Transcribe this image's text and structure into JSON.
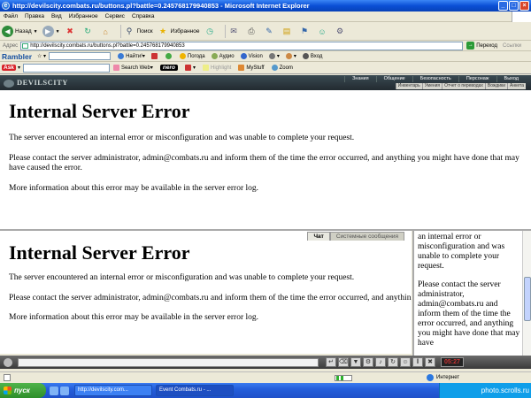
{
  "window": {
    "title": "http://devilscity.combats.ru/buttons.pl?battle=0.245768179940853 - Microsoft Internet Explorer",
    "logo_letter": "e",
    "controls": {
      "minimize": "_",
      "maximize": "□",
      "close": "×"
    }
  },
  "menu": [
    "Файл",
    "Правка",
    "Вид",
    "Избранное",
    "Сервис",
    "Справка"
  ],
  "toolbar": {
    "back": "Назад",
    "search": "Поиск",
    "favorites": "Избранное"
  },
  "address": {
    "label": "Адрес",
    "url": "http://devilscity.combats.ru/buttons.pl?battle=0.245768179940853",
    "go": "Переход",
    "links": "Ссылки"
  },
  "rambler": {
    "brand": "Rambler",
    "find": "Найти!",
    "weather": "Погода",
    "audio": "Аудио",
    "vision": "Vision",
    "login": "Вход"
  },
  "ask": {
    "brand": "Ask",
    "search_web": "Search Web",
    "nero": "nero",
    "highlight": "Highlight",
    "mystuff": "MyStuff",
    "zoom": "Zoom"
  },
  "game": {
    "logo": "DEVILSCITY",
    "topnav": [
      "Знания",
      "Общение",
      "Безопасность",
      "Персонаж",
      "Выход"
    ],
    "subnav": [
      "Инвентарь",
      "Умения",
      "Отчет о переводах",
      "Вождики",
      "Анкета"
    ]
  },
  "error": {
    "title": "Internal Server Error",
    "p1": "The server encountered an internal error or misconfiguration and was unable to complete your request.",
    "p2": "Please contact the server administrator, admin@combats.ru and inform them of the time the error occurred, and anything you might have done that may have caused the error.",
    "p3": "More information about this error may be available in the server error log."
  },
  "chat": {
    "tab_chat": "Чат",
    "tab_system": "Системные сообщения",
    "frag1": "an internal error or misconfiguration and was unable to complete your request.",
    "frag2": "Please contact the server administrator, admin@combats.ru and inform them of the time the error occurred, and anything you might have done that may have",
    "clock": "05:27"
  },
  "status": {
    "zone": "Интернет"
  },
  "taskbar": {
    "start": "пуск",
    "task1": "http://devilscity.com...",
    "task2": "Event Combats.ru - ...",
    "watermark": "photo.scrolls.ru"
  },
  "colors": {
    "title_blue": "#0a4fd6",
    "start_green": "#2d8e2a",
    "taskbar_blue": "#245edb"
  }
}
